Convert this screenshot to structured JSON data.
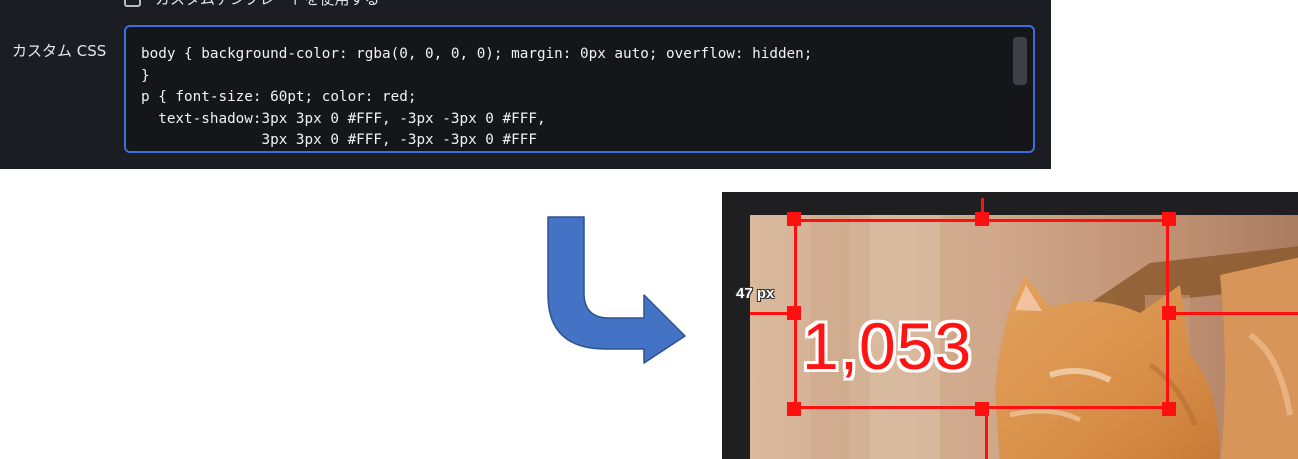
{
  "settings": {
    "template_checkbox_label": "カスタムテンプレートを使用する",
    "custom_css_label": "カスタム CSS",
    "custom_css_lines": [
      "body { background-color: rgba(0, 0, 0, 0); margin: 0px auto; overflow: hidden;",
      "}",
      "p { font-size: 60pt; color: red;",
      "  text-shadow:3px 3px 0 #FFF, -3px -3px 0 #FFF,",
      "              3px 3px 0 #FFF, -3px -3px 0 #FFF"
    ]
  },
  "preview": {
    "count_text": "1,053",
    "margin_label": "47 px",
    "text_color": "#ff1414"
  },
  "icons": {
    "flow_arrow": "curved-down-right-arrow-icon"
  },
  "colors": {
    "panel_bg": "#1b1d22",
    "focus_border": "#3d6de0",
    "arrow_fill": "#4472c4",
    "selection": "#ff1010"
  }
}
